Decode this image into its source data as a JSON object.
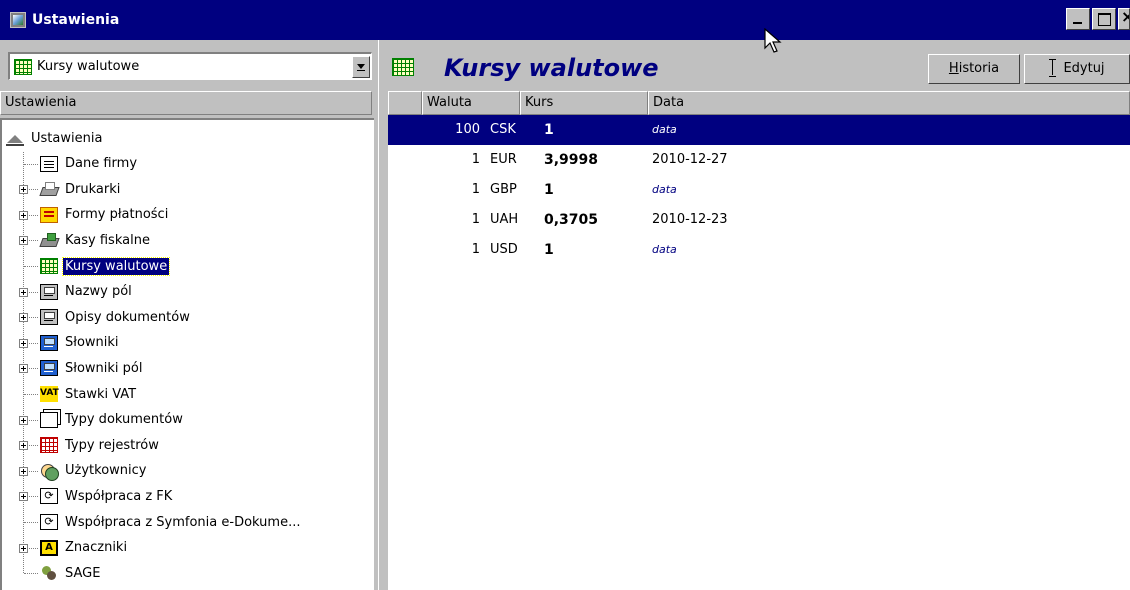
{
  "window": {
    "title": "Ustawienia"
  },
  "left_panel": {
    "combo_value": "Kursy walutowe",
    "header": "Ustawienia",
    "tree": [
      {
        "label": "Ustawienia",
        "icon": "root-icon"
      },
      {
        "label": "Dane firmy",
        "icon": "card-icon"
      },
      {
        "label": "Drukarki",
        "icon": "printer-icon"
      },
      {
        "label": "Formy płatności",
        "icon": "payment-forms-icon"
      },
      {
        "label": "Kasy fiskalne",
        "icon": "cash-register-icon"
      },
      {
        "label": "Kursy walutowe",
        "icon": "grid-icon",
        "selected": true
      },
      {
        "label": "Nazwy pól",
        "icon": "field-icon"
      },
      {
        "label": "Opisy dokumentów",
        "icon": "field-icon"
      },
      {
        "label": "Słowniki",
        "icon": "dictionary-icon"
      },
      {
        "label": "Słowniki pól",
        "icon": "dictionary-icon"
      },
      {
        "label": "Stawki VAT",
        "icon": "vat-icon",
        "icon_text": "VAT"
      },
      {
        "label": "Typy dokumentów",
        "icon": "pages-icon"
      },
      {
        "label": "Typy rejestrów",
        "icon": "register-icon"
      },
      {
        "label": "Użytkownicy",
        "icon": "users-icon"
      },
      {
        "label": "Współpraca z FK",
        "icon": "sync-icon"
      },
      {
        "label": "Współpraca z Symfonia e-Dokume...",
        "icon": "sync-icon"
      },
      {
        "label": "Znaczniki",
        "icon": "tag-icon",
        "icon_text": "A"
      },
      {
        "label": "SAGE",
        "icon": "sage-icon"
      }
    ]
  },
  "right_panel": {
    "title": "Kursy walutowe",
    "buttons": {
      "history_label": "Historia",
      "edit_label": "Edytuj"
    },
    "columns": [
      "",
      "Waluta",
      "Kurs",
      "Data"
    ],
    "rows": [
      {
        "qty": "100",
        "currency": "CSK",
        "rate": "1",
        "date": "data",
        "placeholder": true,
        "selected": true
      },
      {
        "qty": "1",
        "currency": "EUR",
        "rate": "3,9998",
        "date": "2010-12-27",
        "placeholder": false
      },
      {
        "qty": "1",
        "currency": "GBP",
        "rate": "1",
        "date": "data",
        "placeholder": true
      },
      {
        "qty": "1",
        "currency": "UAH",
        "rate": "0,3705",
        "date": "2010-12-23",
        "placeholder": false
      },
      {
        "qty": "1",
        "currency": "USD",
        "rate": "1",
        "date": "data",
        "placeholder": true
      }
    ]
  },
  "colors": {
    "titlebar": "#000080",
    "selection": "#000080",
    "face": "#c0c0c0",
    "accent_title": "#000080"
  }
}
